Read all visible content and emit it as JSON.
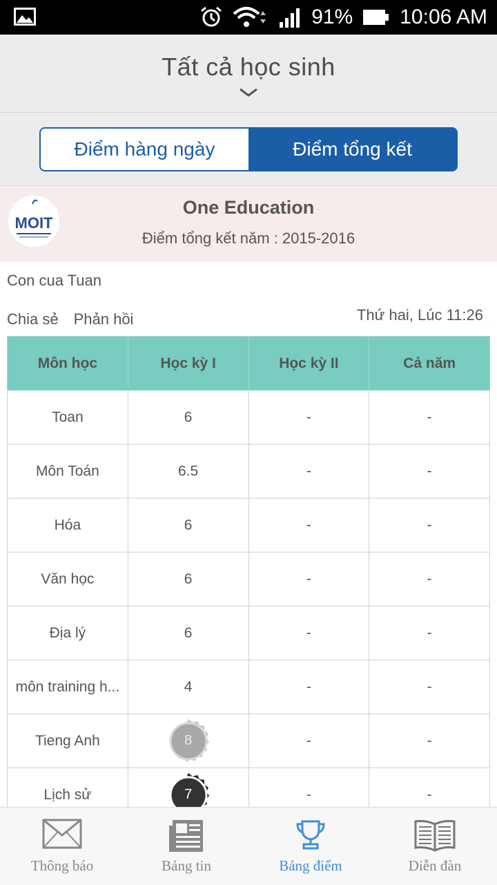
{
  "status_bar": {
    "battery": "91%",
    "time": "10:06 AM",
    "icons": [
      "image-icon",
      "alarm-icon",
      "wifi-icon",
      "signal-icon",
      "battery-icon"
    ]
  },
  "header": {
    "title": "Tất cả học sinh",
    "dropdown_icon": "chevron-down-icon"
  },
  "tabs": {
    "daily": "Điểm hàng ngày",
    "summary": "Điểm tổng kết",
    "active": "summary"
  },
  "school": {
    "logo_text": "MOIT",
    "name": "One Education",
    "subtitle": "Điểm tổng kết năm : 2015-2016"
  },
  "student": {
    "name": "Con cua Tuan",
    "share_label": "Chia sẻ",
    "feedback_label": "Phản hồi",
    "timestamp": "Thứ hai, Lúc 11:26"
  },
  "table": {
    "headers": [
      "Môn học",
      "Học kỳ I",
      "Học kỳ II",
      "Cả năm"
    ],
    "rows": [
      {
        "subject": "Toan",
        "hk1": "6",
        "hk2": "-",
        "year": "-"
      },
      {
        "subject": "Môn Toán",
        "hk1": "6.5",
        "hk2": "-",
        "year": "-"
      },
      {
        "subject": "Hóa",
        "hk1": "6",
        "hk2": "-",
        "year": "-"
      },
      {
        "subject": "Văn học",
        "hk1": "6",
        "hk2": "-",
        "year": "-"
      },
      {
        "subject": "Địa lý",
        "hk1": "6",
        "hk2": "-",
        "year": "-"
      },
      {
        "subject": "môn training h...",
        "hk1": "4",
        "hk2": "-",
        "year": "-"
      },
      {
        "subject": "Tieng Anh",
        "hk1": "8",
        "hk2": "-",
        "year": "-",
        "badge": "silver"
      },
      {
        "subject": "Lịch sử",
        "hk1": "7",
        "hk2": "-",
        "year": "-",
        "badge": "black"
      }
    ]
  },
  "bottom_nav": {
    "items": [
      {
        "label": "Thông báo",
        "icon": "envelope-icon"
      },
      {
        "label": "Bảng tin",
        "icon": "newspaper-icon"
      },
      {
        "label": "Bảng điểm",
        "icon": "trophy-icon"
      },
      {
        "label": "Diễn đàn",
        "icon": "book-icon"
      }
    ],
    "active_index": 2,
    "active_color": "#3d8fdb"
  },
  "colors": {
    "primary": "#1a5ea8",
    "table_header": "#78ccc0",
    "banner_bg": "#f5eceb"
  }
}
